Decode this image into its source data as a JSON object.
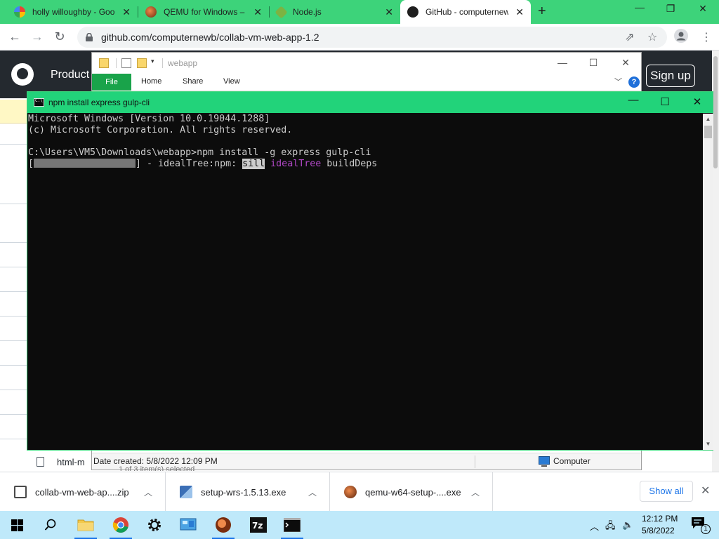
{
  "browser": {
    "tabs": [
      {
        "title": "holly willoughby - Goo",
        "favicon": "google-icon",
        "active": false
      },
      {
        "title": "QEMU for Windows – I",
        "favicon": "qemu-icon",
        "active": false
      },
      {
        "title": "Node.js",
        "favicon": "nodejs-icon",
        "active": false
      },
      {
        "title": "GitHub - computernew",
        "favicon": "github-icon",
        "active": true
      }
    ],
    "new_tab_symbol": "+",
    "url": "github.com/computernewb/collab-vm-web-app-1.2",
    "accent": "#3dd37a"
  },
  "github": {
    "product_label": "Product",
    "signup_label": "Sign up",
    "file_name": "html-m"
  },
  "explorer": {
    "title": "webapp",
    "ribbon": {
      "file": "File",
      "home": "Home",
      "share": "Share",
      "view": "View"
    },
    "help": "?",
    "status": {
      "date_created": "Date created: 5/8/2022 12:09 PM",
      "computer": "Computer",
      "selection": "1 of 3 item(s) selected"
    }
  },
  "console": {
    "title": "npm install express gulp-cli",
    "lines": [
      "Microsoft Windows [Version 10.0.19044.1288]",
      "(c) Microsoft Corporation. All rights reserved.",
      "",
      "C:\\Users\\VM5\\Downloads\\webapp>npm install -g express gulp-cli"
    ],
    "progress": {
      "open": "[",
      "close": "] - idealTree:npm: ",
      "level": "sill",
      "stage": "idealTree",
      "task": " buildDeps"
    }
  },
  "downloads": {
    "items": [
      {
        "name": "collab-vm-web-ap....zip",
        "icon": "zip-file-icon"
      },
      {
        "name": "setup-wrs-1.5.13.exe",
        "icon": "installer-icon"
      },
      {
        "name": "qemu-w64-setup-....exe",
        "icon": "qemu-installer-icon"
      }
    ],
    "show_all": "Show all"
  },
  "taskbar": {
    "time": "12:12 PM",
    "date": "5/8/2022",
    "notification_count": "1"
  }
}
